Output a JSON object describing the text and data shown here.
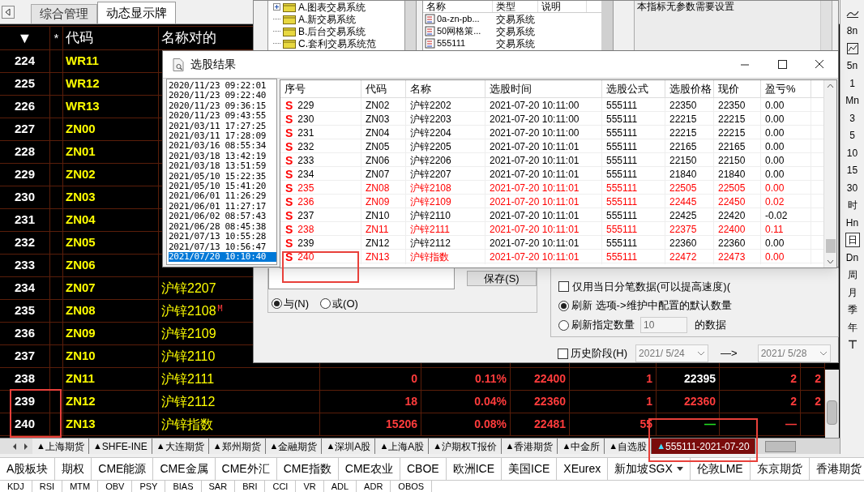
{
  "board": {
    "tabs": [
      {
        "label": "综合管理",
        "selected": false
      },
      {
        "label": "动态显示牌",
        "selected": true
      }
    ],
    "columns": [
      "▼",
      "*",
      "代码",
      "名称对的"
    ],
    "rows": [
      {
        "no": "224",
        "code": "WR11"
      },
      {
        "no": "225",
        "code": "WR12"
      },
      {
        "no": "226",
        "code": "WR13"
      },
      {
        "no": "227",
        "code": "ZN00"
      },
      {
        "no": "228",
        "code": "ZN01"
      },
      {
        "no": "229",
        "code": "ZN02"
      },
      {
        "no": "230",
        "code": "ZN03"
      },
      {
        "no": "231",
        "code": "ZN04"
      },
      {
        "no": "232",
        "code": "ZN05"
      },
      {
        "no": "233",
        "code": "ZN06"
      },
      {
        "no": "234",
        "code": "ZN07",
        "name": "沪锌2207"
      },
      {
        "no": "235",
        "code": "ZN08",
        "name": "沪锌2108",
        "mark": "M"
      },
      {
        "no": "236",
        "code": "ZN09",
        "name": "沪锌2109"
      },
      {
        "no": "237",
        "code": "ZN10",
        "name": "沪锌2110"
      },
      {
        "no": "238",
        "code": "ZN11",
        "name": "沪锌2111",
        "cells": [
          {
            "text": "0",
            "color": "#ff3c3c"
          },
          {
            "text": "0.11%",
            "color": "#ff3c3c"
          },
          {
            "text": "22400",
            "color": "#ff3c3c"
          },
          {
            "text": "1",
            "color": "#ff3c3c"
          },
          {
            "text": "22395",
            "color": "#ffffff"
          },
          {
            "text": "2",
            "color": "#ff3c3c"
          },
          {
            "text": "2",
            "color": "#ff3c3c"
          }
        ]
      },
      {
        "no": "239",
        "code": "ZN12",
        "name": "沪锌2112",
        "cells": [
          {
            "text": "18",
            "color": "#ff3c3c"
          },
          {
            "text": "0.04%",
            "color": "#ff3c3c"
          },
          {
            "text": "22360",
            "color": "#ff3c3c"
          },
          {
            "text": "1",
            "color": "#ff3c3c"
          },
          {
            "text": "22360",
            "color": "#ff3c3c"
          },
          {
            "text": "2",
            "color": "#ff3c3c"
          },
          {
            "text": "2",
            "color": "#ff3c3c"
          }
        ]
      },
      {
        "no": "240",
        "code": "ZN13",
        "name": "沪锌指数",
        "cells": [
          {
            "text": "15206",
            "color": "#ff3c3c"
          },
          {
            "text": "0.08%",
            "color": "#ff3c3c"
          },
          {
            "text": "22481",
            "color": "#ff3c3c"
          },
          {
            "text": "55",
            "color": "#ff3c3c"
          },
          {
            "text": "—",
            "color": "#22e022"
          },
          {
            "text": "—",
            "color": "#ff3c3c"
          }
        ]
      }
    ],
    "sheet_tabs": [
      {
        "marker": "▲",
        "label": "上海期货",
        "selected": false
      },
      {
        "marker": "▲",
        "label": "SHFE-INE",
        "selected": false
      },
      {
        "marker": "▲",
        "label": "大连期货",
        "selected": false
      },
      {
        "marker": "▲",
        "label": "郑州期货",
        "selected": false
      },
      {
        "marker": "▲",
        "label": "金融期货",
        "selected": false
      },
      {
        "marker": "▲",
        "label": "深圳A股",
        "selected": false
      },
      {
        "marker": "▲",
        "label": "上海A股",
        "selected": false
      },
      {
        "marker": "▲",
        "label": "沪期权T报价",
        "selected": false
      },
      {
        "marker": "▲",
        "label": "香港期货",
        "selected": false
      },
      {
        "marker": "▲",
        "label": "中金所",
        "selected": false
      },
      {
        "marker": "▲",
        "label": "自选股",
        "selected": false
      },
      {
        "marker": "▲",
        "label": "555111-2021-07-20",
        "selected": true
      }
    ]
  },
  "formula_dialog": {
    "tree": [
      "A.图表交易系统",
      "A.新交易系统",
      "B.后台交易系统",
      "C.套利交易系统范"
    ],
    "list_columns": [
      "名称",
      "类型",
      "说明"
    ],
    "list_rows": [
      [
        "0a-zn-pb...",
        "交易系统"
      ],
      [
        "50网格策...",
        "交易系统"
      ],
      [
        "555111",
        "交易系统"
      ]
    ],
    "description": "本指标无参数需要设置",
    "save_button": "保存(S)",
    "logic": [
      {
        "label": "与(N)",
        "selected": true
      },
      {
        "label": "或(O)",
        "selected": false
      }
    ],
    "tick_only": {
      "label": "仅用当日分笔数据(可以提高速度)(",
      "checked": false
    },
    "refresh": [
      {
        "label": "刷新 选项->维护中配置的默认数量",
        "selected": true
      },
      {
        "label": "刷新指定数量",
        "selected": false
      }
    ],
    "refresh_count": "10",
    "refresh_suffix": "的数据",
    "history": {
      "label": "历史阶段(H)",
      "checked": false,
      "from": "2021/ 5/24",
      "arrow": "—>",
      "to": "2021/ 5/28"
    }
  },
  "result_window": {
    "title": "选股结果",
    "times": [
      {
        "text": "2020/11/23 09:22:01",
        "selected": false
      },
      {
        "text": "2020/11/23 09:22:40",
        "selected": false
      },
      {
        "text": "2020/11/23 09:36:15",
        "selected": false
      },
      {
        "text": "2020/11/23 09:43:55",
        "selected": false
      },
      {
        "text": "2021/03/11 17:27:25",
        "selected": false
      },
      {
        "text": "2021/03/11 17:28:09",
        "selected": false
      },
      {
        "text": "2021/03/16 08:55:34",
        "selected": false
      },
      {
        "text": "2021/03/18 13:42:19",
        "selected": false
      },
      {
        "text": "2021/03/18 13:51:59",
        "selected": false
      },
      {
        "text": "2021/05/10 15:22:35",
        "selected": false
      },
      {
        "text": "2021/05/10 15:41:20",
        "selected": false
      },
      {
        "text": "2021/06/01 11:26:29",
        "selected": false
      },
      {
        "text": "2021/06/01 11:27:17",
        "selected": false
      },
      {
        "text": "2021/06/02 08:57:43",
        "selected": false
      },
      {
        "text": "2021/06/28 08:45:38",
        "selected": false
      },
      {
        "text": "2021/07/13 10:55:28",
        "selected": false
      },
      {
        "text": "2021/07/13 10:56:47",
        "selected": false
      },
      {
        "text": "2021/07/20 10:10:40",
        "selected": true
      }
    ],
    "columns": [
      "序号",
      "代码",
      "名称",
      "选股时间",
      "选股公式",
      "选股价格",
      "现价",
      "盈亏%"
    ],
    "rows": [
      {
        "signal": "S",
        "no": "229",
        "code": "ZN02",
        "name": "沪锌2202",
        "time": "2021-07-20 10:11:00",
        "formula": "555111",
        "pick_price": "22350",
        "price": "22350",
        "pnl": "0.00",
        "highlighted": false
      },
      {
        "signal": "S",
        "no": "230",
        "code": "ZN03",
        "name": "沪锌2203",
        "time": "2021-07-20 10:11:00",
        "formula": "555111",
        "pick_price": "22215",
        "price": "22215",
        "pnl": "0.00",
        "highlighted": false
      },
      {
        "signal": "S",
        "no": "231",
        "code": "ZN04",
        "name": "沪锌2204",
        "time": "2021-07-20 10:11:00",
        "formula": "555111",
        "pick_price": "22215",
        "price": "22215",
        "pnl": "0.00",
        "highlighted": false
      },
      {
        "signal": "S",
        "no": "232",
        "code": "ZN05",
        "name": "沪锌2205",
        "time": "2021-07-20 10:11:01",
        "formula": "555111",
        "pick_price": "22165",
        "price": "22165",
        "pnl": "0.00",
        "highlighted": false
      },
      {
        "signal": "S",
        "no": "233",
        "code": "ZN06",
        "name": "沪锌2206",
        "time": "2021-07-20 10:11:01",
        "formula": "555111",
        "pick_price": "22150",
        "price": "22150",
        "pnl": "0.00",
        "highlighted": false
      },
      {
        "signal": "S",
        "no": "234",
        "code": "ZN07",
        "name": "沪锌2207",
        "time": "2021-07-20 10:11:01",
        "formula": "555111",
        "pick_price": "21840",
        "price": "21840",
        "pnl": "0.00",
        "highlighted": false
      },
      {
        "signal": "S",
        "no": "235",
        "code": "ZN08",
        "name": "沪锌2108",
        "time": "2021-07-20 10:11:01",
        "formula": "555111",
        "pick_price": "22505",
        "price": "22505",
        "pnl": "0.00",
        "highlighted": true
      },
      {
        "signal": "S",
        "no": "236",
        "code": "ZN09",
        "name": "沪锌2109",
        "time": "2021-07-20 10:11:01",
        "formula": "555111",
        "pick_price": "22445",
        "price": "22450",
        "pnl": "0.02",
        "highlighted": true
      },
      {
        "signal": "S",
        "no": "237",
        "code": "ZN10",
        "name": "沪锌2110",
        "time": "2021-07-20 10:11:01",
        "formula": "555111",
        "pick_price": "22425",
        "price": "22420",
        "pnl": "-0.02",
        "highlighted": false
      },
      {
        "signal": "S",
        "no": "238",
        "code": "ZN11",
        "name": "沪锌2111",
        "time": "2021-07-20 10:11:01",
        "formula": "555111",
        "pick_price": "22375",
        "price": "22400",
        "pnl": "0.11",
        "highlighted": true
      },
      {
        "signal": "S",
        "no": "239",
        "code": "ZN12",
        "name": "沪锌2112",
        "time": "2021-07-20 10:11:01",
        "formula": "555111",
        "pick_price": "22360",
        "price": "22360",
        "pnl": "0.00",
        "highlighted": false
      },
      {
        "signal": "S",
        "no": "240",
        "code": "ZN13",
        "name": "沪锌指数",
        "time": "2021-07-20 10:11:01",
        "formula": "555111",
        "pick_price": "22472",
        "price": "22473",
        "pnl": "0.00",
        "highlighted": true
      }
    ]
  },
  "right_toolbar": [
    {
      "kind": "trend"
    },
    {
      "kind": "text",
      "label": "8n",
      "selected": false
    },
    {
      "kind": "chart"
    },
    {
      "kind": "text",
      "label": "5n",
      "selected": false
    },
    {
      "kind": "text",
      "label": "1",
      "selected": false
    },
    {
      "kind": "text",
      "label": "Mn",
      "selected": false
    },
    {
      "kind": "text",
      "label": "3",
      "selected": false
    },
    {
      "kind": "text",
      "label": "5",
      "selected": false
    },
    {
      "kind": "text",
      "label": "10",
      "selected": false
    },
    {
      "kind": "text",
      "label": "15",
      "selected": false
    },
    {
      "kind": "text",
      "label": "30",
      "selected": false
    },
    {
      "kind": "text",
      "label": "时",
      "selected": false
    },
    {
      "kind": "text",
      "label": "Hn",
      "selected": false
    },
    {
      "kind": "text",
      "label": "日",
      "selected": true
    },
    {
      "kind": "text",
      "label": "Dn",
      "selected": false
    },
    {
      "kind": "text",
      "label": "周",
      "selected": false
    },
    {
      "kind": "text",
      "label": "月",
      "selected": false
    },
    {
      "kind": "text",
      "label": "季",
      "selected": false
    },
    {
      "kind": "text",
      "label": "年",
      "selected": false
    },
    {
      "kind": "pin"
    }
  ],
  "quote_bar": [
    {
      "label": "A股板块",
      "dropdown": false
    },
    {
      "label": "期权",
      "dropdown": false
    },
    {
      "label": "CME能源",
      "dropdown": false
    },
    {
      "label": "CME金属",
      "dropdown": false
    },
    {
      "label": "CME外汇",
      "dropdown": false
    },
    {
      "label": "CME指数",
      "dropdown": false
    },
    {
      "label": "CME农业",
      "dropdown": false
    },
    {
      "label": "CBOE",
      "dropdown": false
    },
    {
      "label": "欧洲ICE",
      "dropdown": false
    },
    {
      "label": "美国ICE",
      "dropdown": false
    },
    {
      "label": "XEurex",
      "dropdown": false
    },
    {
      "label": "新加坡SGX",
      "dropdown": true
    },
    {
      "label": "伦敦LME",
      "dropdown": false
    },
    {
      "label": "东京期货",
      "dropdown": false
    },
    {
      "label": "香港期货",
      "dropdown": false
    }
  ],
  "indicator_bar": [
    "KDJ",
    "RSI",
    "MTM",
    "OBV",
    "PSY",
    "BIAS",
    "SAR",
    "BRI",
    "CCI",
    "VR",
    "ADL",
    "ADR",
    "OBOS"
  ]
}
